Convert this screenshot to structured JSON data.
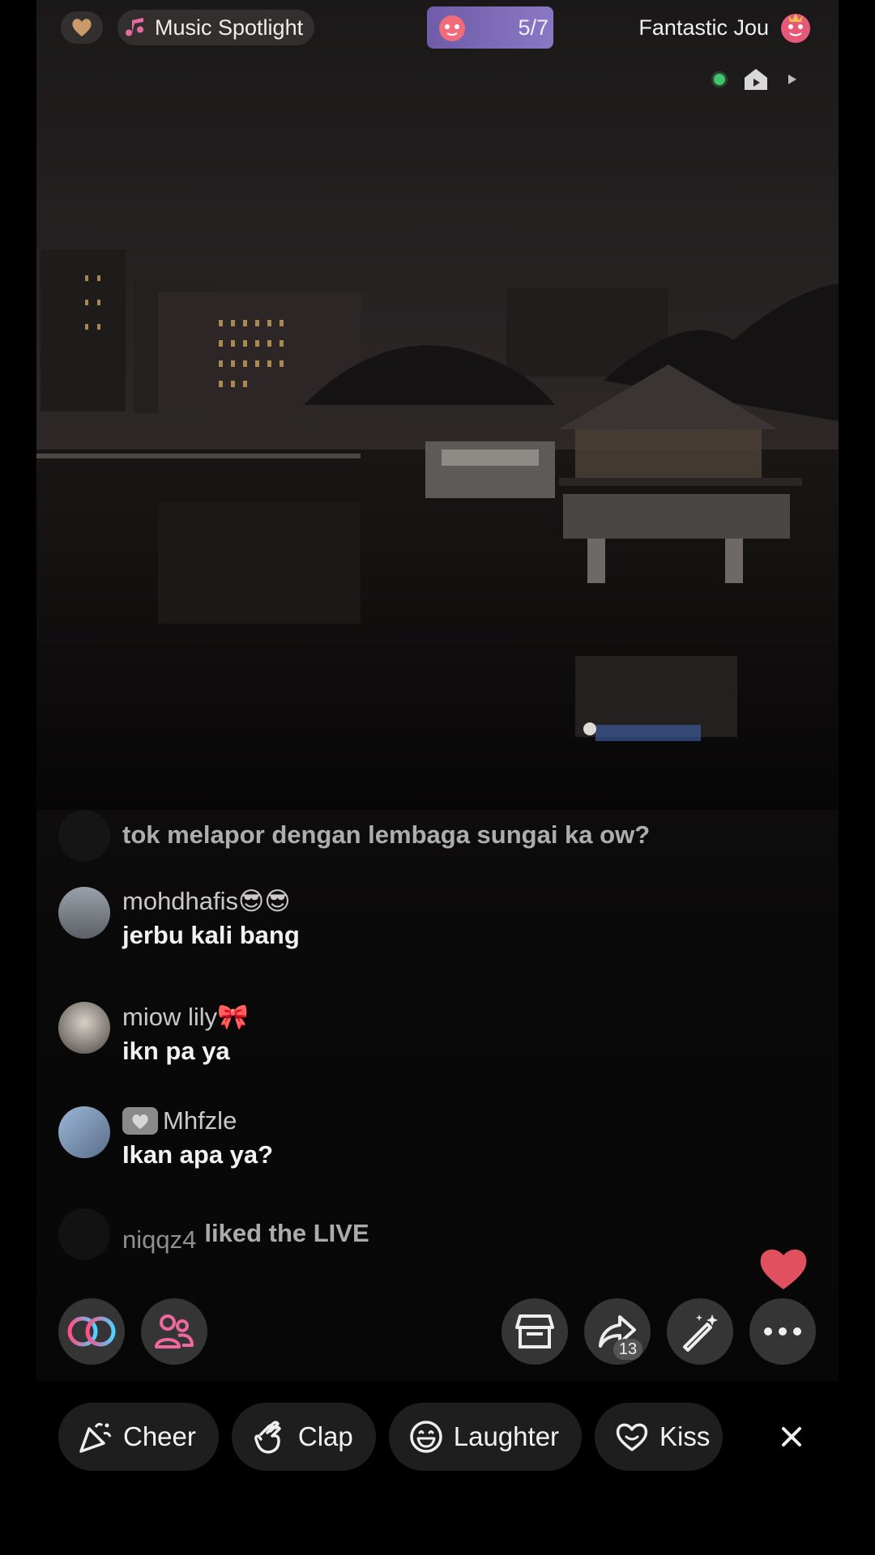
{
  "top_bar": {
    "spotlight_label": "Music Spotlight",
    "rank": "5/7",
    "host_name": "Fantastic Jou"
  },
  "comments": [
    {
      "username": "",
      "message": "tok melapor dengan lembaga sungai ka ow?"
    },
    {
      "username": "mohdhafis😎😎",
      "message": "jerbu kali bang"
    },
    {
      "username": "miow lily🎀",
      "message": "ikn pa ya"
    },
    {
      "username": "Mhfzle",
      "message": "Ikan apa ya?"
    },
    {
      "username": "niqqz4",
      "message": "liked the LIVE"
    }
  ],
  "actions": {
    "share_count": "13"
  },
  "reactions": [
    {
      "label": "Cheer",
      "icon": "party-popper-icon"
    },
    {
      "label": "Clap",
      "icon": "clap-icon"
    },
    {
      "label": "Laughter",
      "icon": "laugh-icon"
    },
    {
      "label": "Kiss",
      "icon": "heart-outline-icon"
    }
  ],
  "colors": {
    "accent_pill": "#7c6bb6",
    "like_heart": "#e0505e",
    "online_dot": "#41c46b"
  }
}
